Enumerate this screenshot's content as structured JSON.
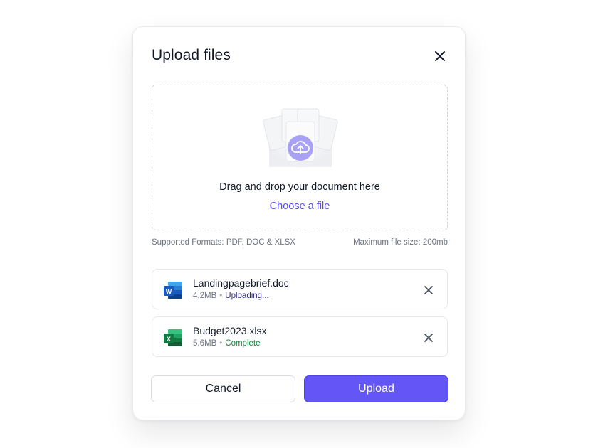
{
  "dialog": {
    "title": "Upload files",
    "close_icon": "close-icon"
  },
  "dropzone": {
    "icon": "cloud-upload-icon",
    "prompt": "Drag and drop your document here",
    "choose_link": "Choose a file"
  },
  "constraints": {
    "formats": "Supported Formats: PDF, DOC & XLSX",
    "max_size": "Maximum file size: 200mb"
  },
  "files": [
    {
      "name": "Landingpagebrief.doc",
      "size": "4.2MB",
      "status": "Uploading...",
      "icon": "word-doc-icon",
      "status_color": "#312e81"
    },
    {
      "name": "Budget2023.xlsx",
      "size": "5.6MB",
      "status": "Complete",
      "icon": "excel-sheet-icon",
      "status_color": "#15803d"
    }
  ],
  "separator": "•",
  "actions": {
    "cancel_label": "Cancel",
    "upload_label": "Upload"
  },
  "colors": {
    "accent": "#6355f6",
    "link": "#5b4ff0"
  }
}
